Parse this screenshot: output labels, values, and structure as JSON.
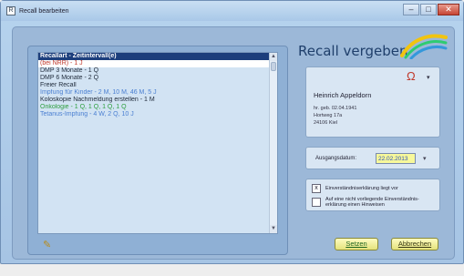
{
  "window": {
    "title": "Recall bearbeiten",
    "app_icon": "R",
    "controls": {
      "minimize": "–",
      "maximize": "□",
      "close": "✕"
    }
  },
  "recall_list": {
    "header": "Recallart - Zeitintervall(e)",
    "items": [
      {
        "label": "(bei NRR) - 1 J",
        "color": "#c0392b",
        "selected": true
      },
      {
        "label": "DMP 3 Monate - 1 Q",
        "color": "#1f2a3a",
        "selected": false
      },
      {
        "label": "DMP 6 Monate - 2 Q",
        "color": "#1f2a3a",
        "selected": false
      },
      {
        "label": "Freier Recall",
        "color": "#1f2a3a",
        "selected": false
      },
      {
        "label": "Impfung für Kinder - 2 M, 10 M, 46 M, 5 J",
        "color": "#4a7fd1",
        "selected": false
      },
      {
        "label": "Koloskopie Nachmeldung erstellen - 1 M",
        "color": "#1f2a3a",
        "selected": false
      },
      {
        "label": "Onkologie - 1 Q, 1 Q, 1 Q, 1 Q",
        "color": "#2e9e3e",
        "selected": false
      },
      {
        "label": "Tetanus-Impfung - 4 W, 2 Q, 10 J",
        "color": "#4a7fd1",
        "selected": false
      }
    ],
    "scroll_up": "▲",
    "scroll_down": "▼"
  },
  "edit_icon": "✎",
  "brand": {
    "title": "Recall vergeben",
    "colors": [
      "#f1c40f",
      "#2ecc71",
      "#3498db"
    ]
  },
  "patient": {
    "icon": "Ω",
    "dropdown": "▾",
    "name": "Heinrich Appeldorn",
    "birth": "hr. geb. 02.04.1941",
    "street": "Hortweg 17a",
    "city": "24106 Kiel"
  },
  "date": {
    "label": "Ausgangsdatum:",
    "value": "22.02.2013",
    "dropdown": "▾"
  },
  "consent": {
    "consent_given": {
      "checked": true,
      "mark": "x",
      "label": "Einverständniserklärung liegt vor"
    },
    "reminder": {
      "checked": false,
      "mark": "",
      "label": "Auf eine nicht vorliegende Einverständnis- erklärung einen Hinweisen"
    }
  },
  "buttons": {
    "setzen": "Setzen",
    "abbrechen": "Abbrechen"
  }
}
